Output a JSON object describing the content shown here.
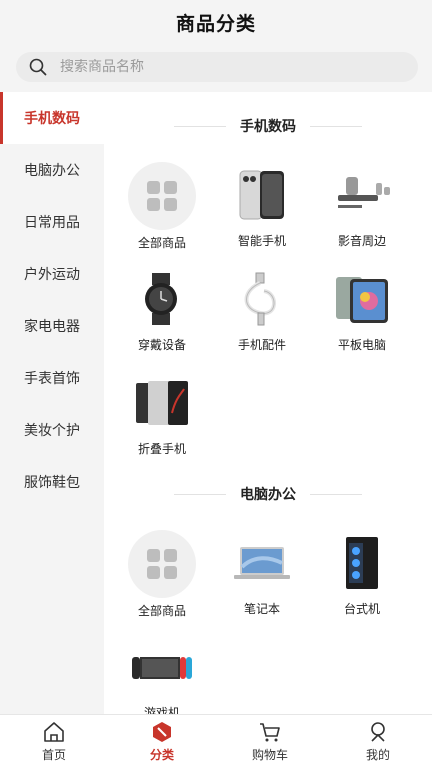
{
  "header": {
    "title": "商品分类"
  },
  "search": {
    "placeholder": "搜索商品名称"
  },
  "sidebar": {
    "items": [
      {
        "label": "手机数码",
        "active": true
      },
      {
        "label": "电脑办公"
      },
      {
        "label": "日常用品"
      },
      {
        "label": "户外运动"
      },
      {
        "label": "家电电器"
      },
      {
        "label": "手表首饰"
      },
      {
        "label": "美妆个护"
      },
      {
        "label": "服饰鞋包"
      }
    ]
  },
  "sections": [
    {
      "title": "手机数码",
      "items": [
        {
          "label": "全部商品",
          "icon": "grid-icon"
        },
        {
          "label": "智能手机",
          "icon": "smartphone-icon"
        },
        {
          "label": "影音周边",
          "icon": "speaker-icon"
        },
        {
          "label": "穿戴设备",
          "icon": "smartwatch-icon"
        },
        {
          "label": "手机配件",
          "icon": "cable-icon"
        },
        {
          "label": "平板电脑",
          "icon": "tablet-icon"
        },
        {
          "label": "折叠手机",
          "icon": "foldable-phone-icon"
        }
      ]
    },
    {
      "title": "电脑办公",
      "items": [
        {
          "label": "全部商品",
          "icon": "grid-icon"
        },
        {
          "label": "笔记本",
          "icon": "laptop-icon"
        },
        {
          "label": "台式机",
          "icon": "desktop-tower-icon"
        },
        {
          "label": "游戏机",
          "icon": "game-console-icon"
        }
      ]
    }
  ],
  "tabbar": {
    "items": [
      {
        "label": "首页",
        "icon": "home-icon"
      },
      {
        "label": "分类",
        "icon": "category-icon",
        "active": true
      },
      {
        "label": "购物车",
        "icon": "cart-icon"
      },
      {
        "label": "我的",
        "icon": "profile-icon"
      }
    ]
  },
  "colors": {
    "accent": "#c8352b",
    "background": "#f4f4f4"
  }
}
